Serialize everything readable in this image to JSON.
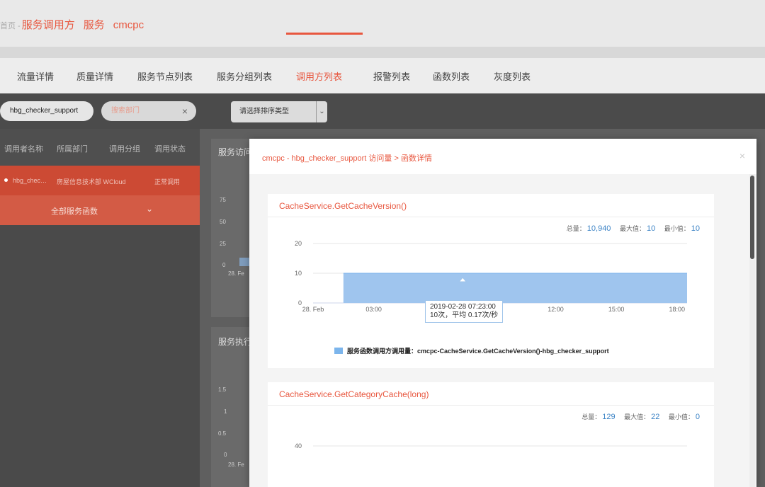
{
  "breadcrumb": {
    "home": "首页 -",
    "items": [
      "服务调用方",
      "服务",
      "cmcpc"
    ]
  },
  "tabs": [
    {
      "label": "流量详情",
      "active": false
    },
    {
      "label": "质量详情",
      "active": false
    },
    {
      "label": "服务节点列表",
      "active": false
    },
    {
      "label": "服务分组列表",
      "active": false
    },
    {
      "label": "调用方列表",
      "active": true
    },
    {
      "label": "报警列表",
      "active": false
    },
    {
      "label": "函数列表",
      "active": false
    },
    {
      "label": "灰度列表",
      "active": false
    }
  ],
  "filters": {
    "app_value": "hbg_checker_support",
    "dept_placeholder": "搜索部门",
    "clear_icon": "×",
    "sort_placeholder": "请选择排序类型",
    "sort_chevron": "⌄"
  },
  "sidebar": {
    "headers": [
      "调用者名称",
      "所属部门",
      "调用分组",
      "调用状态"
    ],
    "row": {
      "name": "hbg_chec…",
      "dept": "房屋信息技术部 WCloud",
      "status": "正常调用"
    },
    "all_functions": "全部服务函数",
    "chevron": "⌄"
  },
  "background": {
    "panel1_title": "服务访问",
    "panel2_title": "服务执行",
    "panel1_ticks": [
      "75",
      "50",
      "25",
      "0"
    ],
    "panel1_xtick": "28. Fe",
    "panel2_ticks": [
      "1.5",
      "1",
      "0.5",
      "0"
    ],
    "panel2_xtick": "28. Fe"
  },
  "modal": {
    "title": "cmcpc - hbg_checker_support 访问量 > 函数详情",
    "close": "×",
    "cards": [
      {
        "title": "CacheService.GetCacheVersion()",
        "stats": {
          "total_label": "总量：",
          "total": "10,940",
          "max_label": "最大值：",
          "max": "10",
          "min_label": "最小值：",
          "min": "10"
        },
        "tooltip": {
          "line1": "2019-02-28 07:23:00",
          "line2": "10次，平均 0.17次/秒"
        },
        "legend": "服务函数调用方调用量：cmcpc-CacheService.GetCacheVersion()-hbg_checker_support"
      },
      {
        "title": "CacheService.GetCategoryCache(long)",
        "stats": {
          "total_label": "总量：",
          "total": "129",
          "max_label": "最大值：",
          "max": "22",
          "min_label": "最小值：",
          "min": "0"
        }
      }
    ]
  },
  "chart_data": [
    {
      "type": "area",
      "title": "CacheService.GetCacheVersion()",
      "x_ticks": [
        "28. Feb",
        "03:00",
        "06:00",
        "09:00",
        "12:00",
        "15:00",
        "18:00"
      ],
      "x_range_hours": [
        0,
        18.5
      ],
      "ylim": [
        0,
        20
      ],
      "y_ticks": [
        0,
        10,
        20
      ],
      "series": [
        {
          "name": "服务函数调用方调用量：cmcpc-CacheService.GetCacheVersion()-hbg_checker_support",
          "x_hours": [
            1.5,
            18.5
          ],
          "values": [
            10,
            10
          ]
        }
      ],
      "color": "#9fc5ee",
      "grid": true
    },
    {
      "type": "area",
      "title": "CacheService.GetCategoryCache(long)",
      "y_ticks": [
        40
      ],
      "grid": true
    }
  ]
}
